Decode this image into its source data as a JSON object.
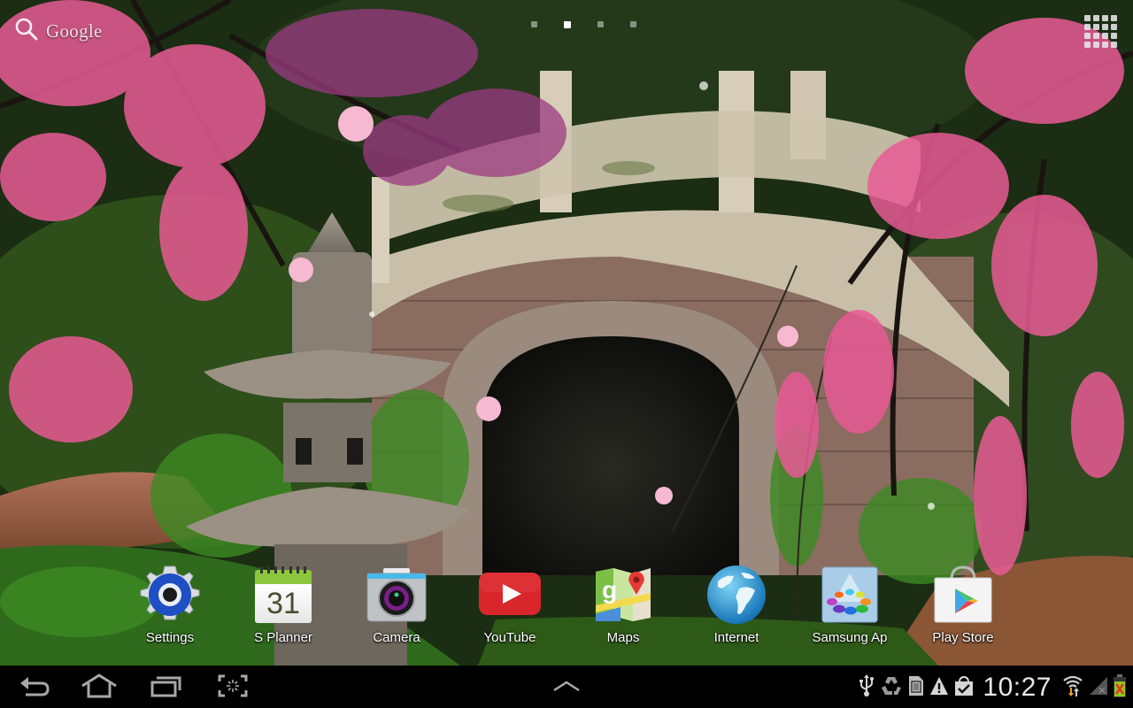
{
  "home_screen": {
    "search_widget": {
      "label": "Google",
      "icon": "search-icon"
    },
    "page_indicator": {
      "pages": 4,
      "active_index": 1
    },
    "apps_button": {
      "icon": "app-grid-icon"
    },
    "apps": [
      {
        "label": "Settings",
        "icon": "settings-gear-icon"
      },
      {
        "label": "S Planner",
        "icon": "calendar-icon",
        "date": "31"
      },
      {
        "label": "Camera",
        "icon": "camera-icon"
      },
      {
        "label": "YouTube",
        "icon": "youtube-icon"
      },
      {
        "label": "Maps",
        "icon": "maps-icon"
      },
      {
        "label": "Internet",
        "icon": "globe-icon"
      },
      {
        "label": "Samsung Ap",
        "icon": "samsung-apps-icon"
      },
      {
        "label": "Play Store",
        "icon": "play-store-icon"
      }
    ]
  },
  "system_bar": {
    "nav": [
      {
        "name": "back",
        "icon": "back-icon"
      },
      {
        "name": "home",
        "icon": "home-icon"
      },
      {
        "name": "recent-apps",
        "icon": "recent-apps-icon"
      },
      {
        "name": "screenshot",
        "icon": "screen-capture-icon"
      }
    ],
    "expand": {
      "icon": "chevron-up-icon"
    },
    "status_icons": [
      "usb-icon",
      "recycle-sync-icon",
      "sd-card-icon",
      "warning-icon",
      "shopping-bag-check-icon"
    ],
    "clock": "10:27",
    "wifi": "wifi-activity-icon",
    "signal": "no-signal-icon",
    "battery": "battery-not-charging-icon"
  },
  "colors": {
    "settings_blue": "#1f4fc4",
    "calendar_green": "#8cc63f",
    "youtube_red": "#d8262b",
    "blossom_pink": "#e85a95",
    "system_bar": "#000000",
    "system_icon": "#b8b8b8"
  }
}
